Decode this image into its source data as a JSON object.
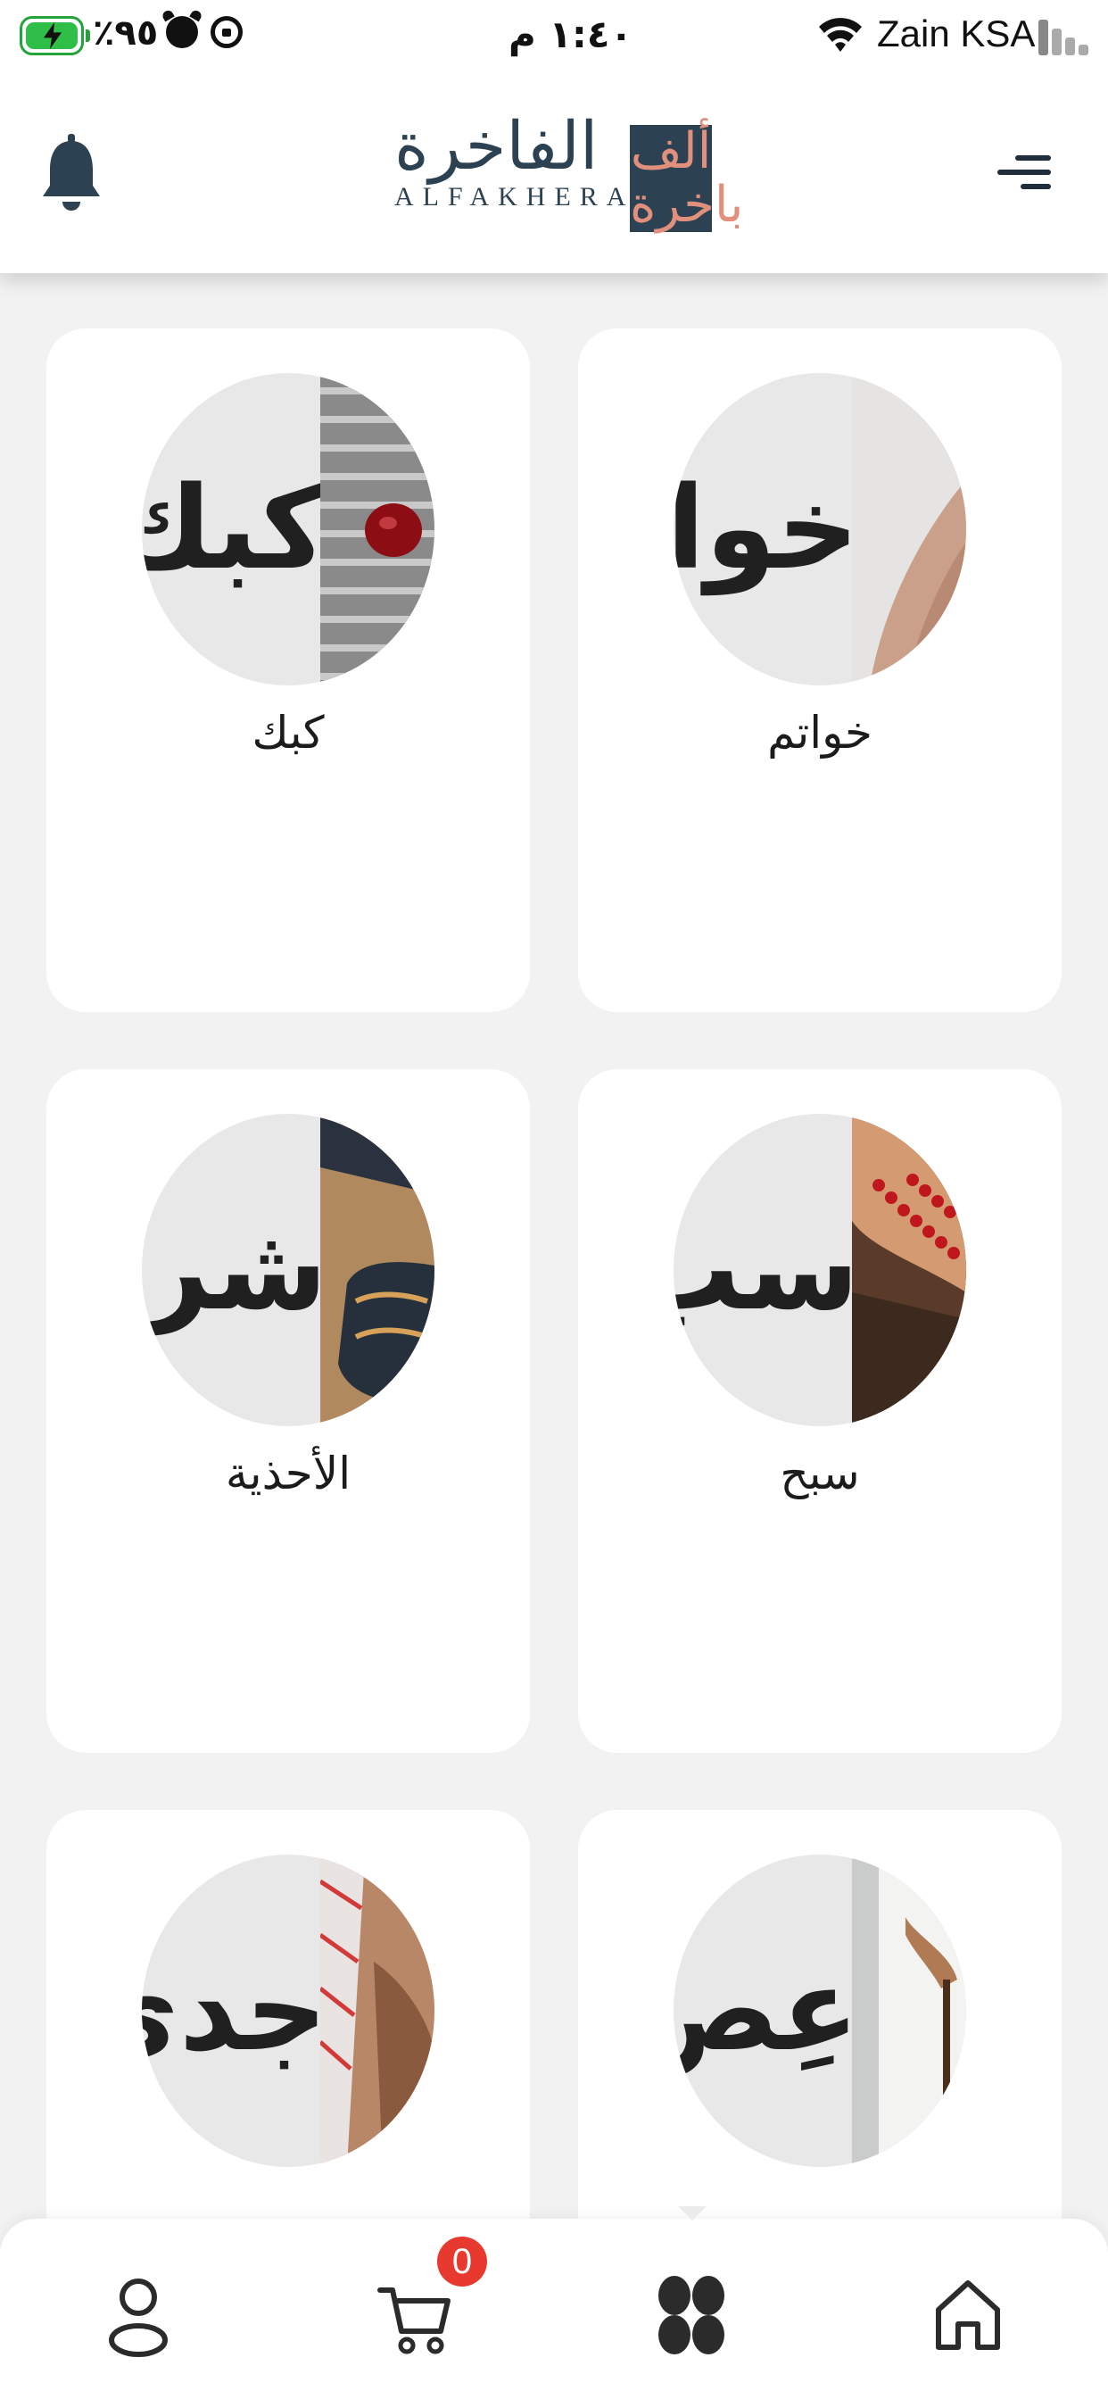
{
  "status_bar": {
    "battery_percent": "٪٩٥",
    "time": "١:٤٠ م",
    "carrier": "Zain KSA",
    "colors": {
      "battery": "#2fbf48"
    }
  },
  "header": {
    "logo_arabic": "الفاخرة",
    "logo_latin": "ALFAKHERA",
    "logo_mark": "ألف باخرة",
    "icons": {
      "left": "bell-icon",
      "right": "menu-icon"
    },
    "colors": {
      "primary": "#2c4253",
      "accent": "#e0907c"
    }
  },
  "categories": [
    {
      "label": "خواتم",
      "image_text": "خوا"
    },
    {
      "label": "كبك",
      "image_text": "كبك"
    },
    {
      "label": "سبح",
      "image_text": "سب"
    },
    {
      "label": "الأحذية",
      "image_text": "شرف"
    },
    {
      "label": "",
      "image_text": "عِص"
    },
    {
      "label": "",
      "image_text": "جدي"
    }
  ],
  "bottom_nav": {
    "items": [
      {
        "icon": "home-icon"
      },
      {
        "icon": "categories-icon",
        "active": true
      },
      {
        "icon": "cart-icon"
      },
      {
        "icon": "profile-icon"
      }
    ],
    "cart_count": "0",
    "colors": {
      "badge": "#e8392f",
      "icon": "#2b2b2b"
    }
  }
}
